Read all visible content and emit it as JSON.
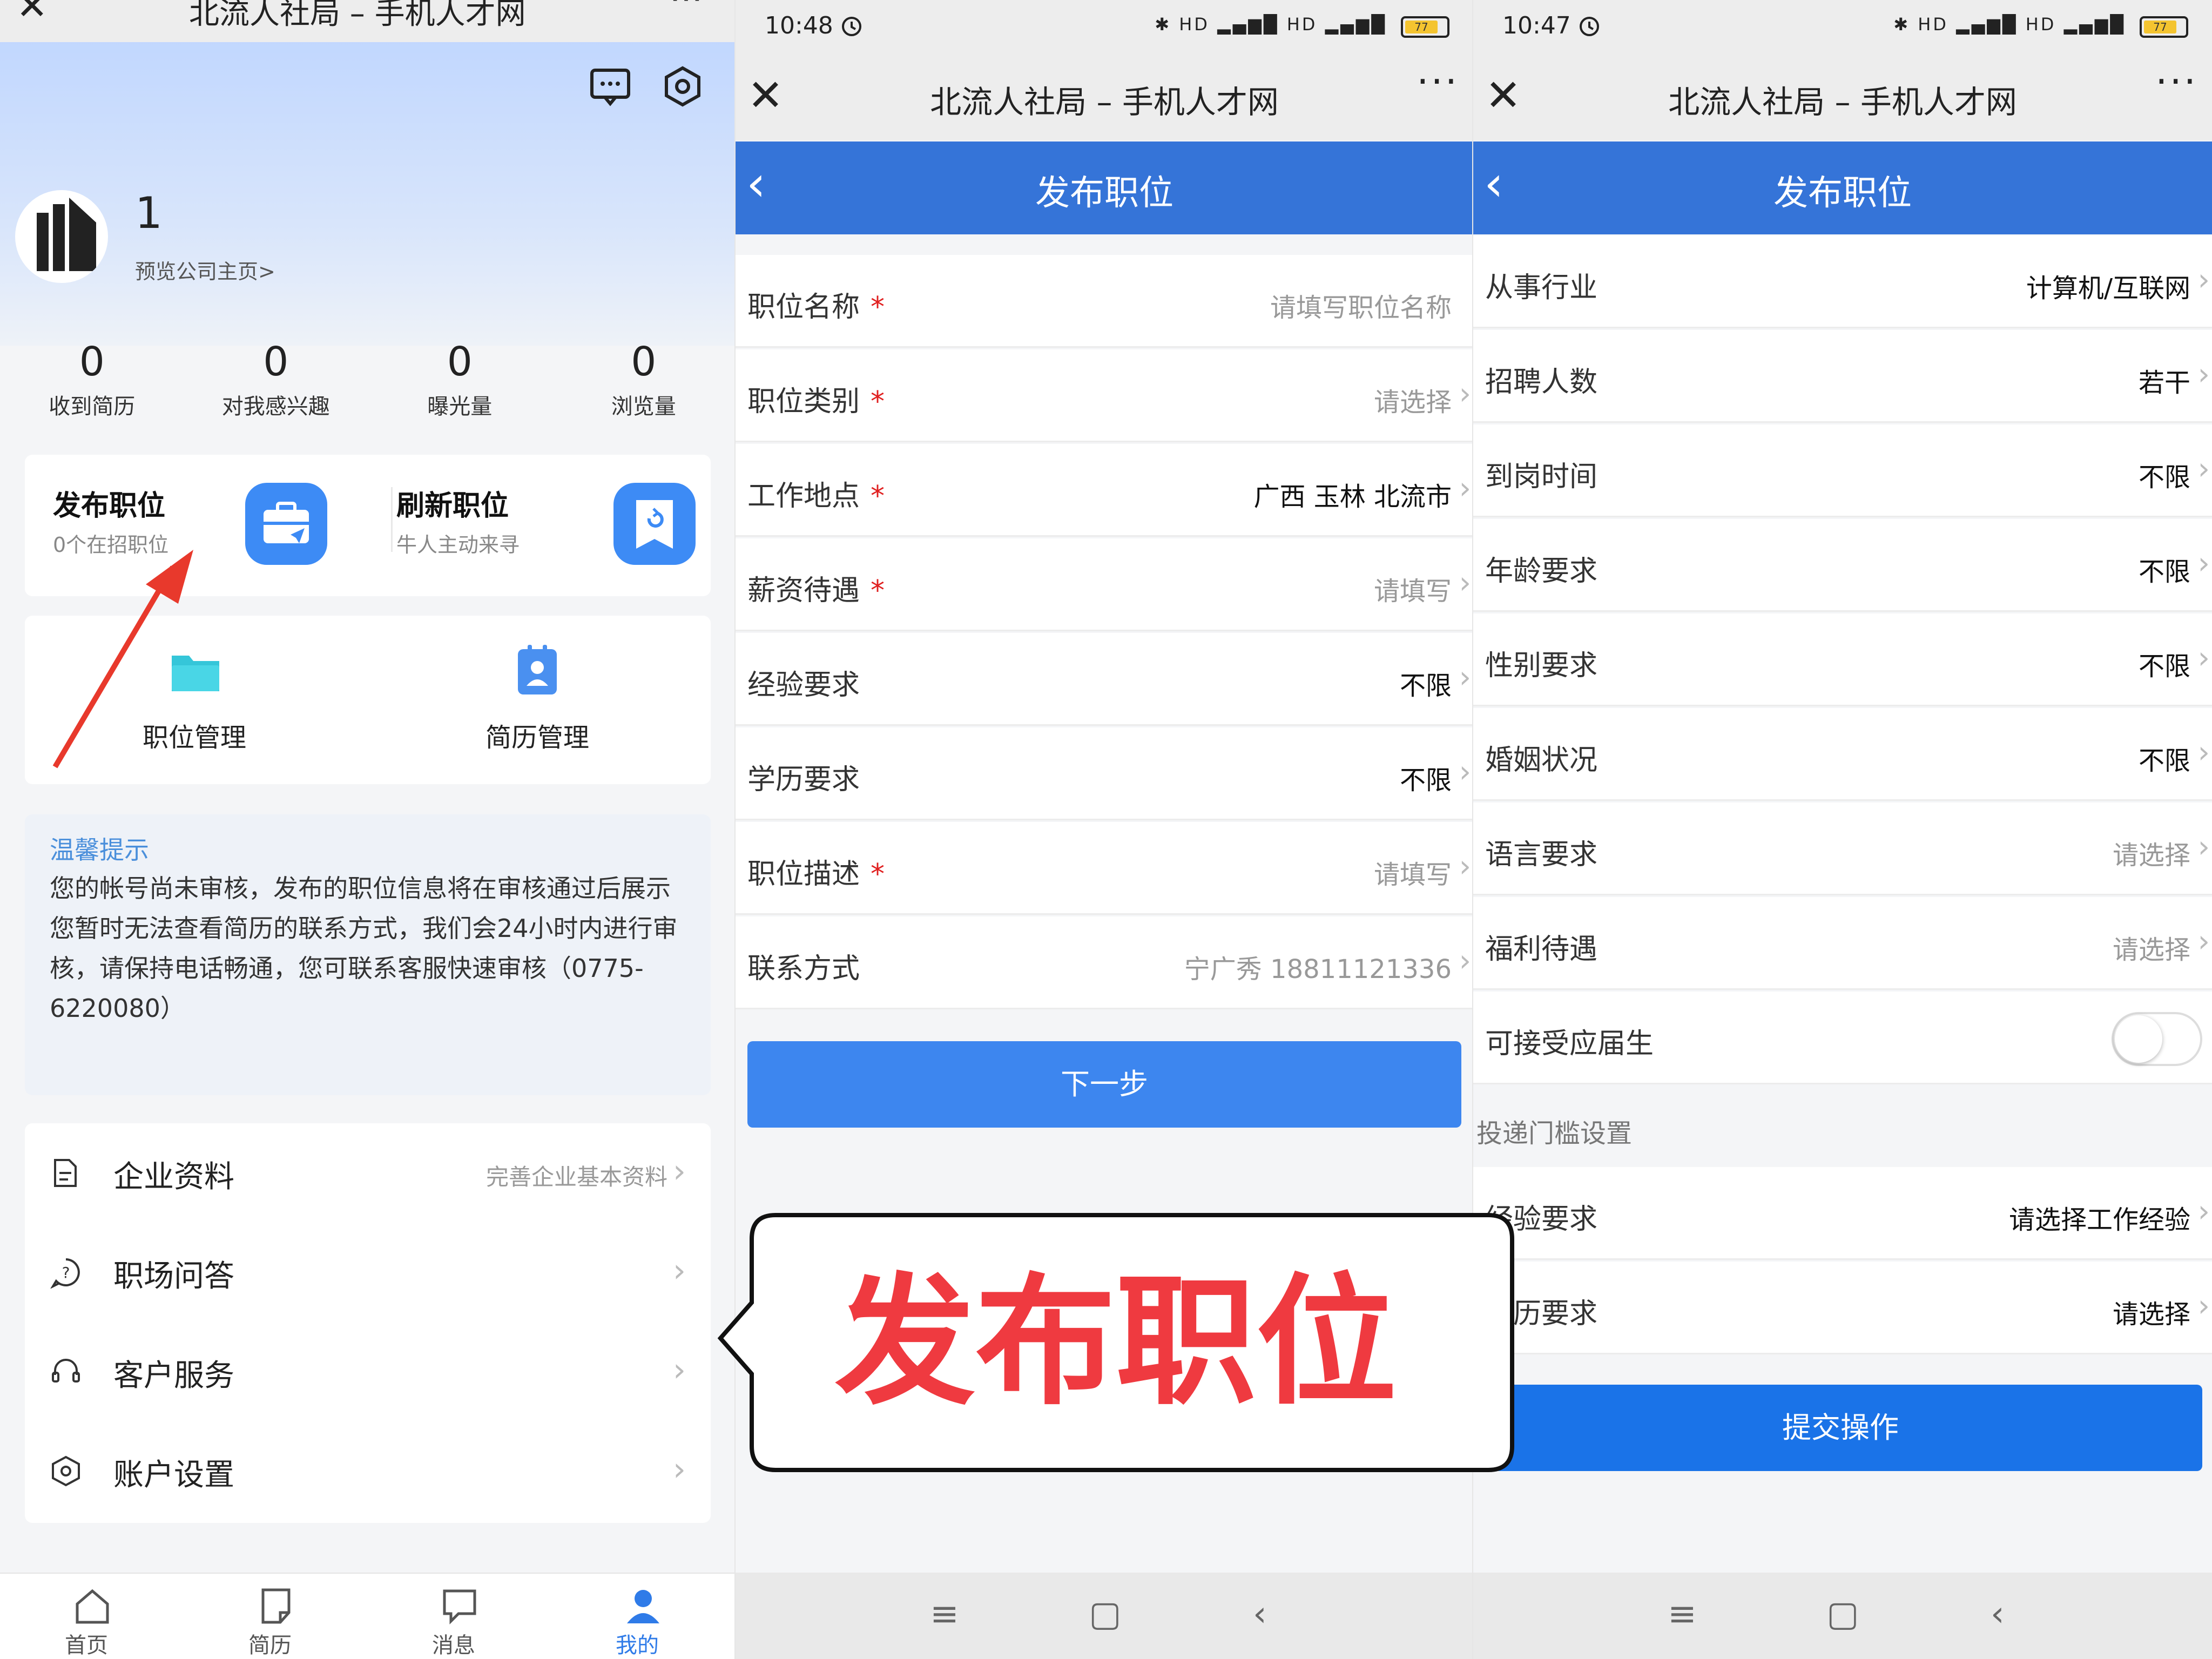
{
  "panel1": {
    "window_title": "北流人社局 – 手机人才网",
    "company_name": "1",
    "preview_link": "预览公司主页>",
    "stats": [
      {
        "value": "0",
        "label": "收到简历"
      },
      {
        "value": "0",
        "label": "对我感兴趣"
      },
      {
        "value": "0",
        "label": "曝光量"
      },
      {
        "value": "0",
        "label": "浏览量"
      }
    ],
    "publish": {
      "title": "发布职位",
      "sub": "0个在招职位"
    },
    "refresh": {
      "title": "刷新职位",
      "sub": "牛人主动来寻"
    },
    "grid": [
      {
        "label": "职位管理"
      },
      {
        "label": "简历管理"
      }
    ],
    "tips": {
      "head": "温馨提示",
      "line1": "您的帐号尚未审核，发布的职位信息将在审核通过后展示",
      "line2": "您暂时无法查看简历的联系方式，我们会24小时内进行审核，请保持电话畅通，您可联系客服快速审核（0775-6220080）"
    },
    "menu": [
      {
        "label": "企业资料",
        "hint": "完善企业基本资料"
      },
      {
        "label": "职场问答",
        "hint": ""
      },
      {
        "label": "客户服务",
        "hint": ""
      },
      {
        "label": "账户设置",
        "hint": ""
      }
    ],
    "tabs": [
      {
        "label": "首页"
      },
      {
        "label": "简历"
      },
      {
        "label": "消息"
      },
      {
        "label": "我的"
      }
    ],
    "active_tab_color": "#2f7be8"
  },
  "panel2": {
    "time": "10:48",
    "battery": "77",
    "window_title": "北流人社局 – 手机人才网",
    "page_title": "发布职位",
    "fields": [
      {
        "label": "职位名称",
        "required": "*",
        "value": "请填写职位名称",
        "placeholder": true
      },
      {
        "label": "职位类别",
        "required": "*",
        "value": "请选择",
        "placeholder": true
      },
      {
        "label": "工作地点",
        "required": "*",
        "value": "广西 玉林 北流市",
        "placeholder": false
      },
      {
        "label": "薪资待遇",
        "required": "*",
        "value": "请填写",
        "placeholder": true
      },
      {
        "label": "经验要求",
        "required": "",
        "value": "不限",
        "placeholder": false
      },
      {
        "label": "学历要求",
        "required": "",
        "value": "不限",
        "placeholder": false
      },
      {
        "label": "职位描述",
        "required": "*",
        "value": "请填写",
        "placeholder": true
      },
      {
        "label": "联系方式",
        "required": "",
        "value": "宁广秀 18811121336",
        "placeholder": true
      }
    ],
    "next_button": "下一步",
    "button_color": "#3d86ef"
  },
  "panel3": {
    "time": "10:47",
    "battery": "77",
    "window_title": "北流人社局 – 手机人才网",
    "page_title": "发布职位",
    "fields": [
      {
        "label": "从事行业",
        "value": "计算机/互联网",
        "placeholder": false
      },
      {
        "label": "招聘人数",
        "value": "若干",
        "placeholder": false
      },
      {
        "label": "到岗时间",
        "value": "不限",
        "placeholder": false
      },
      {
        "label": "年龄要求",
        "value": "不限",
        "placeholder": false
      },
      {
        "label": "性别要求",
        "value": "不限",
        "placeholder": false
      },
      {
        "label": "婚姻状况",
        "value": "不限",
        "placeholder": false
      },
      {
        "label": "语言要求",
        "value": "请选择",
        "placeholder": true
      },
      {
        "label": "福利待遇",
        "value": "请选择",
        "placeholder": true
      }
    ],
    "fresh_grad_label": "可接受应届生",
    "fresh_grad_on": false,
    "section_head": "投递门槛设置",
    "threshold_fields": [
      {
        "label": "经验要求",
        "value": "请选择工作经验"
      },
      {
        "label": "学历要求",
        "value": "请选择"
      }
    ],
    "submit_button": "提交操作",
    "button_color": "#1a73e8"
  },
  "callout": {
    "text": "发布职位",
    "color": "#ef3a40"
  },
  "annotation_arrow_color": "#e8392c"
}
